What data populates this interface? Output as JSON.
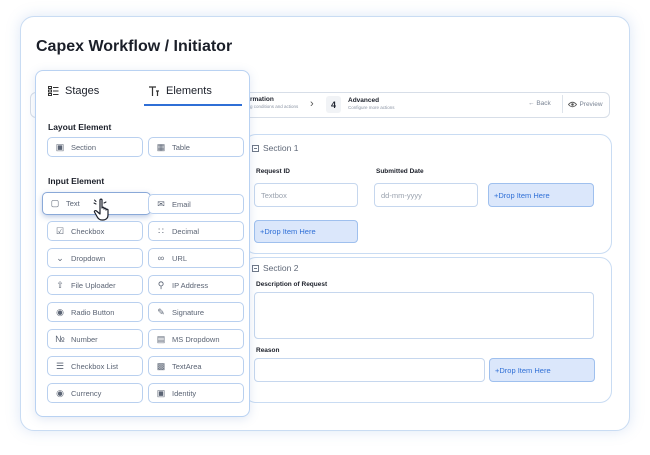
{
  "page": {
    "title": "Capex Workflow / Initiator"
  },
  "stepper": {
    "prev_title": "rmation",
    "prev_sub": "g conditions and actions",
    "current_number": "4",
    "current_title": "Advanced",
    "current_sub": "Configure more actions",
    "back_label": "Back",
    "preview_label": "Preview"
  },
  "panel": {
    "tabs": [
      {
        "label": "Stages",
        "icon": "stages-icon"
      },
      {
        "label": "Elements",
        "icon": "elements-icon"
      }
    ],
    "active_tab": "Elements",
    "layout_title": "Layout Element",
    "layout_items": [
      {
        "label": "Section",
        "icon": "section-icon"
      },
      {
        "label": "Table",
        "icon": "table-icon"
      }
    ],
    "input_title": "Input Element",
    "input_items": [
      {
        "label": "Text",
        "icon": "text-icon"
      },
      {
        "label": "Email",
        "icon": "email-icon"
      },
      {
        "label": "Checkbox",
        "icon": "checkbox-icon"
      },
      {
        "label": "Decimal",
        "icon": "decimal-icon"
      },
      {
        "label": "Dropdown",
        "icon": "dropdown-icon"
      },
      {
        "label": "URL",
        "icon": "link-icon"
      },
      {
        "label": "File Uploader",
        "icon": "file-upload-icon"
      },
      {
        "label": "IP Address",
        "icon": "ip-address-icon"
      },
      {
        "label": "Radio Button",
        "icon": "radio-button-icon"
      },
      {
        "label": "Signature",
        "icon": "signature-icon"
      },
      {
        "label": "Number",
        "icon": "number-icon"
      },
      {
        "label": "MS Dropdown",
        "icon": "ms-dropdown-icon"
      },
      {
        "label": "Checkbox List",
        "icon": "checkbox-list-icon"
      },
      {
        "label": "TextArea",
        "icon": "textarea-icon"
      },
      {
        "label": "Currency",
        "icon": "currency-icon"
      },
      {
        "label": "Identity",
        "icon": "identity-icon"
      }
    ]
  },
  "section1": {
    "title": "Section 1",
    "request_id_label": "Request ID",
    "request_id_placeholder": "Textbox",
    "submitted_date_label": "Submitted Date",
    "submitted_date_placeholder": "dd-mm-yyyy",
    "drop_label_1": "+Drop Item Here",
    "drop_label_2": "+Drop Item Here"
  },
  "section2": {
    "title": "Section 2",
    "description_label": "Description of Request",
    "reason_label": "Reason",
    "drop_label": "+Drop Item Here"
  },
  "colors": {
    "accent": "#2f6fd6",
    "drop_bg": "#dbe7fb",
    "border": "#c9dcf3"
  }
}
